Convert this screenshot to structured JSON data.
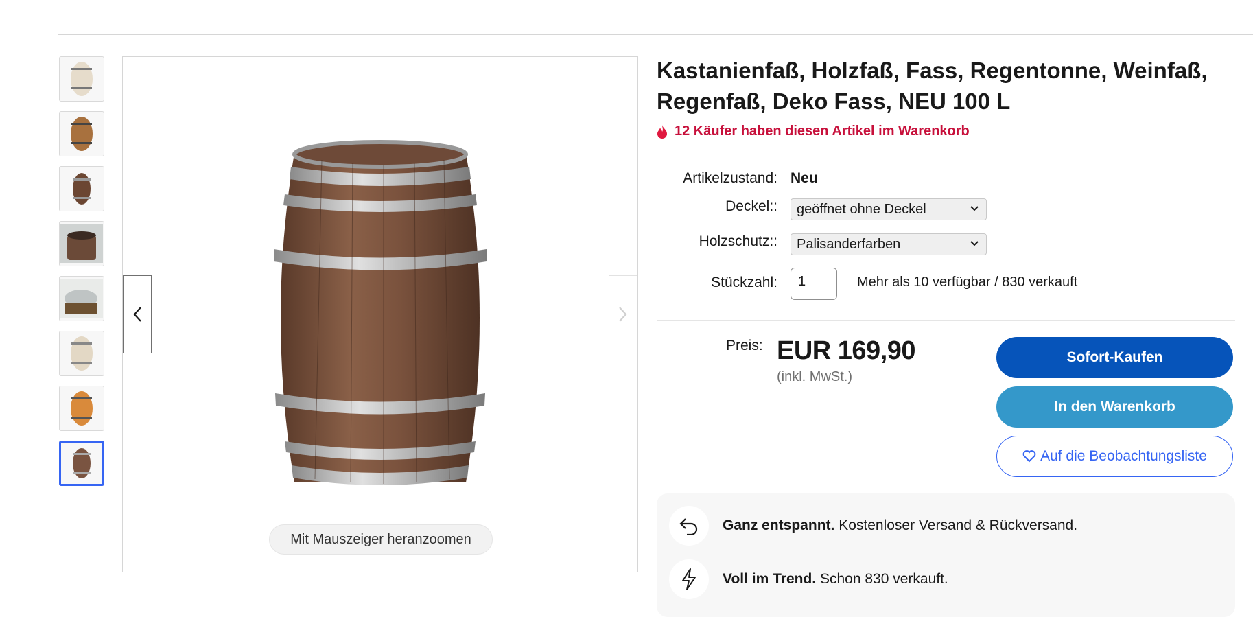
{
  "product": {
    "title": "Kastanienfaß, Holzfaß, Fass, Regentonne, Weinfaß, Regenfaß, Deko Fass, NEU 100 L",
    "hot_text": "12 Käufer haben diesen Artikel im Warenkorb"
  },
  "gallery": {
    "zoom_hint": "Mit Mauszeiger heranzoomen",
    "thumbnail_count": 8,
    "selected_thumbnail": 8
  },
  "details": {
    "condition_label": "Artikelzustand:",
    "condition_value": "Neu",
    "lid_label": "Deckel::",
    "lid_value": "geöffnet ohne Deckel",
    "wood_label": "Holzschutz::",
    "wood_value": "Palisanderfarben",
    "qty_label": "Stückzahl:",
    "qty_value": "1",
    "availability": "Mehr als 10 verfügbar / 830 verkauft"
  },
  "price": {
    "label": "Preis:",
    "amount": "EUR 169,90",
    "vat": "(inkl. MwSt.)"
  },
  "buttons": {
    "buy_now": "Sofort-Kaufen",
    "add_to_cart": "In den Warenkorb",
    "watchlist": "Auf die Beobachtungsliste"
  },
  "perks": {
    "shipping_bold": "Ganz entspannt.",
    "shipping_text": "Kostenloser Versand & Rückversand.",
    "trend_bold": "Voll im Trend.",
    "trend_text": "Schon 830 verkauft."
  },
  "colors": {
    "buy_now": "#0654ba",
    "add_to_cart": "#3498ca",
    "hot_text": "#c7103b",
    "selected_thumb": "#3665f3"
  }
}
